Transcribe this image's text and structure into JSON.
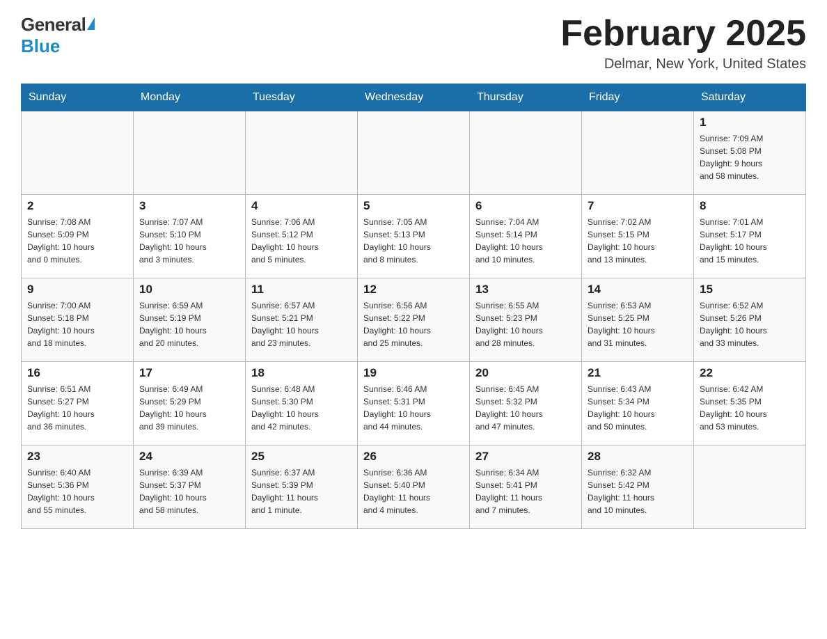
{
  "logo": {
    "general": "General",
    "blue": "Blue"
  },
  "title": "February 2025",
  "location": "Delmar, New York, United States",
  "days_of_week": [
    "Sunday",
    "Monday",
    "Tuesday",
    "Wednesday",
    "Thursday",
    "Friday",
    "Saturday"
  ],
  "weeks": [
    {
      "days": [
        {
          "number": "",
          "info": ""
        },
        {
          "number": "",
          "info": ""
        },
        {
          "number": "",
          "info": ""
        },
        {
          "number": "",
          "info": ""
        },
        {
          "number": "",
          "info": ""
        },
        {
          "number": "",
          "info": ""
        },
        {
          "number": "1",
          "info": "Sunrise: 7:09 AM\nSunset: 5:08 PM\nDaylight: 9 hours\nand 58 minutes."
        }
      ]
    },
    {
      "days": [
        {
          "number": "2",
          "info": "Sunrise: 7:08 AM\nSunset: 5:09 PM\nDaylight: 10 hours\nand 0 minutes."
        },
        {
          "number": "3",
          "info": "Sunrise: 7:07 AM\nSunset: 5:10 PM\nDaylight: 10 hours\nand 3 minutes."
        },
        {
          "number": "4",
          "info": "Sunrise: 7:06 AM\nSunset: 5:12 PM\nDaylight: 10 hours\nand 5 minutes."
        },
        {
          "number": "5",
          "info": "Sunrise: 7:05 AM\nSunset: 5:13 PM\nDaylight: 10 hours\nand 8 minutes."
        },
        {
          "number": "6",
          "info": "Sunrise: 7:04 AM\nSunset: 5:14 PM\nDaylight: 10 hours\nand 10 minutes."
        },
        {
          "number": "7",
          "info": "Sunrise: 7:02 AM\nSunset: 5:15 PM\nDaylight: 10 hours\nand 13 minutes."
        },
        {
          "number": "8",
          "info": "Sunrise: 7:01 AM\nSunset: 5:17 PM\nDaylight: 10 hours\nand 15 minutes."
        }
      ]
    },
    {
      "days": [
        {
          "number": "9",
          "info": "Sunrise: 7:00 AM\nSunset: 5:18 PM\nDaylight: 10 hours\nand 18 minutes."
        },
        {
          "number": "10",
          "info": "Sunrise: 6:59 AM\nSunset: 5:19 PM\nDaylight: 10 hours\nand 20 minutes."
        },
        {
          "number": "11",
          "info": "Sunrise: 6:57 AM\nSunset: 5:21 PM\nDaylight: 10 hours\nand 23 minutes."
        },
        {
          "number": "12",
          "info": "Sunrise: 6:56 AM\nSunset: 5:22 PM\nDaylight: 10 hours\nand 25 minutes."
        },
        {
          "number": "13",
          "info": "Sunrise: 6:55 AM\nSunset: 5:23 PM\nDaylight: 10 hours\nand 28 minutes."
        },
        {
          "number": "14",
          "info": "Sunrise: 6:53 AM\nSunset: 5:25 PM\nDaylight: 10 hours\nand 31 minutes."
        },
        {
          "number": "15",
          "info": "Sunrise: 6:52 AM\nSunset: 5:26 PM\nDaylight: 10 hours\nand 33 minutes."
        }
      ]
    },
    {
      "days": [
        {
          "number": "16",
          "info": "Sunrise: 6:51 AM\nSunset: 5:27 PM\nDaylight: 10 hours\nand 36 minutes."
        },
        {
          "number": "17",
          "info": "Sunrise: 6:49 AM\nSunset: 5:29 PM\nDaylight: 10 hours\nand 39 minutes."
        },
        {
          "number": "18",
          "info": "Sunrise: 6:48 AM\nSunset: 5:30 PM\nDaylight: 10 hours\nand 42 minutes."
        },
        {
          "number": "19",
          "info": "Sunrise: 6:46 AM\nSunset: 5:31 PM\nDaylight: 10 hours\nand 44 minutes."
        },
        {
          "number": "20",
          "info": "Sunrise: 6:45 AM\nSunset: 5:32 PM\nDaylight: 10 hours\nand 47 minutes."
        },
        {
          "number": "21",
          "info": "Sunrise: 6:43 AM\nSunset: 5:34 PM\nDaylight: 10 hours\nand 50 minutes."
        },
        {
          "number": "22",
          "info": "Sunrise: 6:42 AM\nSunset: 5:35 PM\nDaylight: 10 hours\nand 53 minutes."
        }
      ]
    },
    {
      "days": [
        {
          "number": "23",
          "info": "Sunrise: 6:40 AM\nSunset: 5:36 PM\nDaylight: 10 hours\nand 55 minutes."
        },
        {
          "number": "24",
          "info": "Sunrise: 6:39 AM\nSunset: 5:37 PM\nDaylight: 10 hours\nand 58 minutes."
        },
        {
          "number": "25",
          "info": "Sunrise: 6:37 AM\nSunset: 5:39 PM\nDaylight: 11 hours\nand 1 minute."
        },
        {
          "number": "26",
          "info": "Sunrise: 6:36 AM\nSunset: 5:40 PM\nDaylight: 11 hours\nand 4 minutes."
        },
        {
          "number": "27",
          "info": "Sunrise: 6:34 AM\nSunset: 5:41 PM\nDaylight: 11 hours\nand 7 minutes."
        },
        {
          "number": "28",
          "info": "Sunrise: 6:32 AM\nSunset: 5:42 PM\nDaylight: 11 hours\nand 10 minutes."
        },
        {
          "number": "",
          "info": ""
        }
      ]
    }
  ]
}
